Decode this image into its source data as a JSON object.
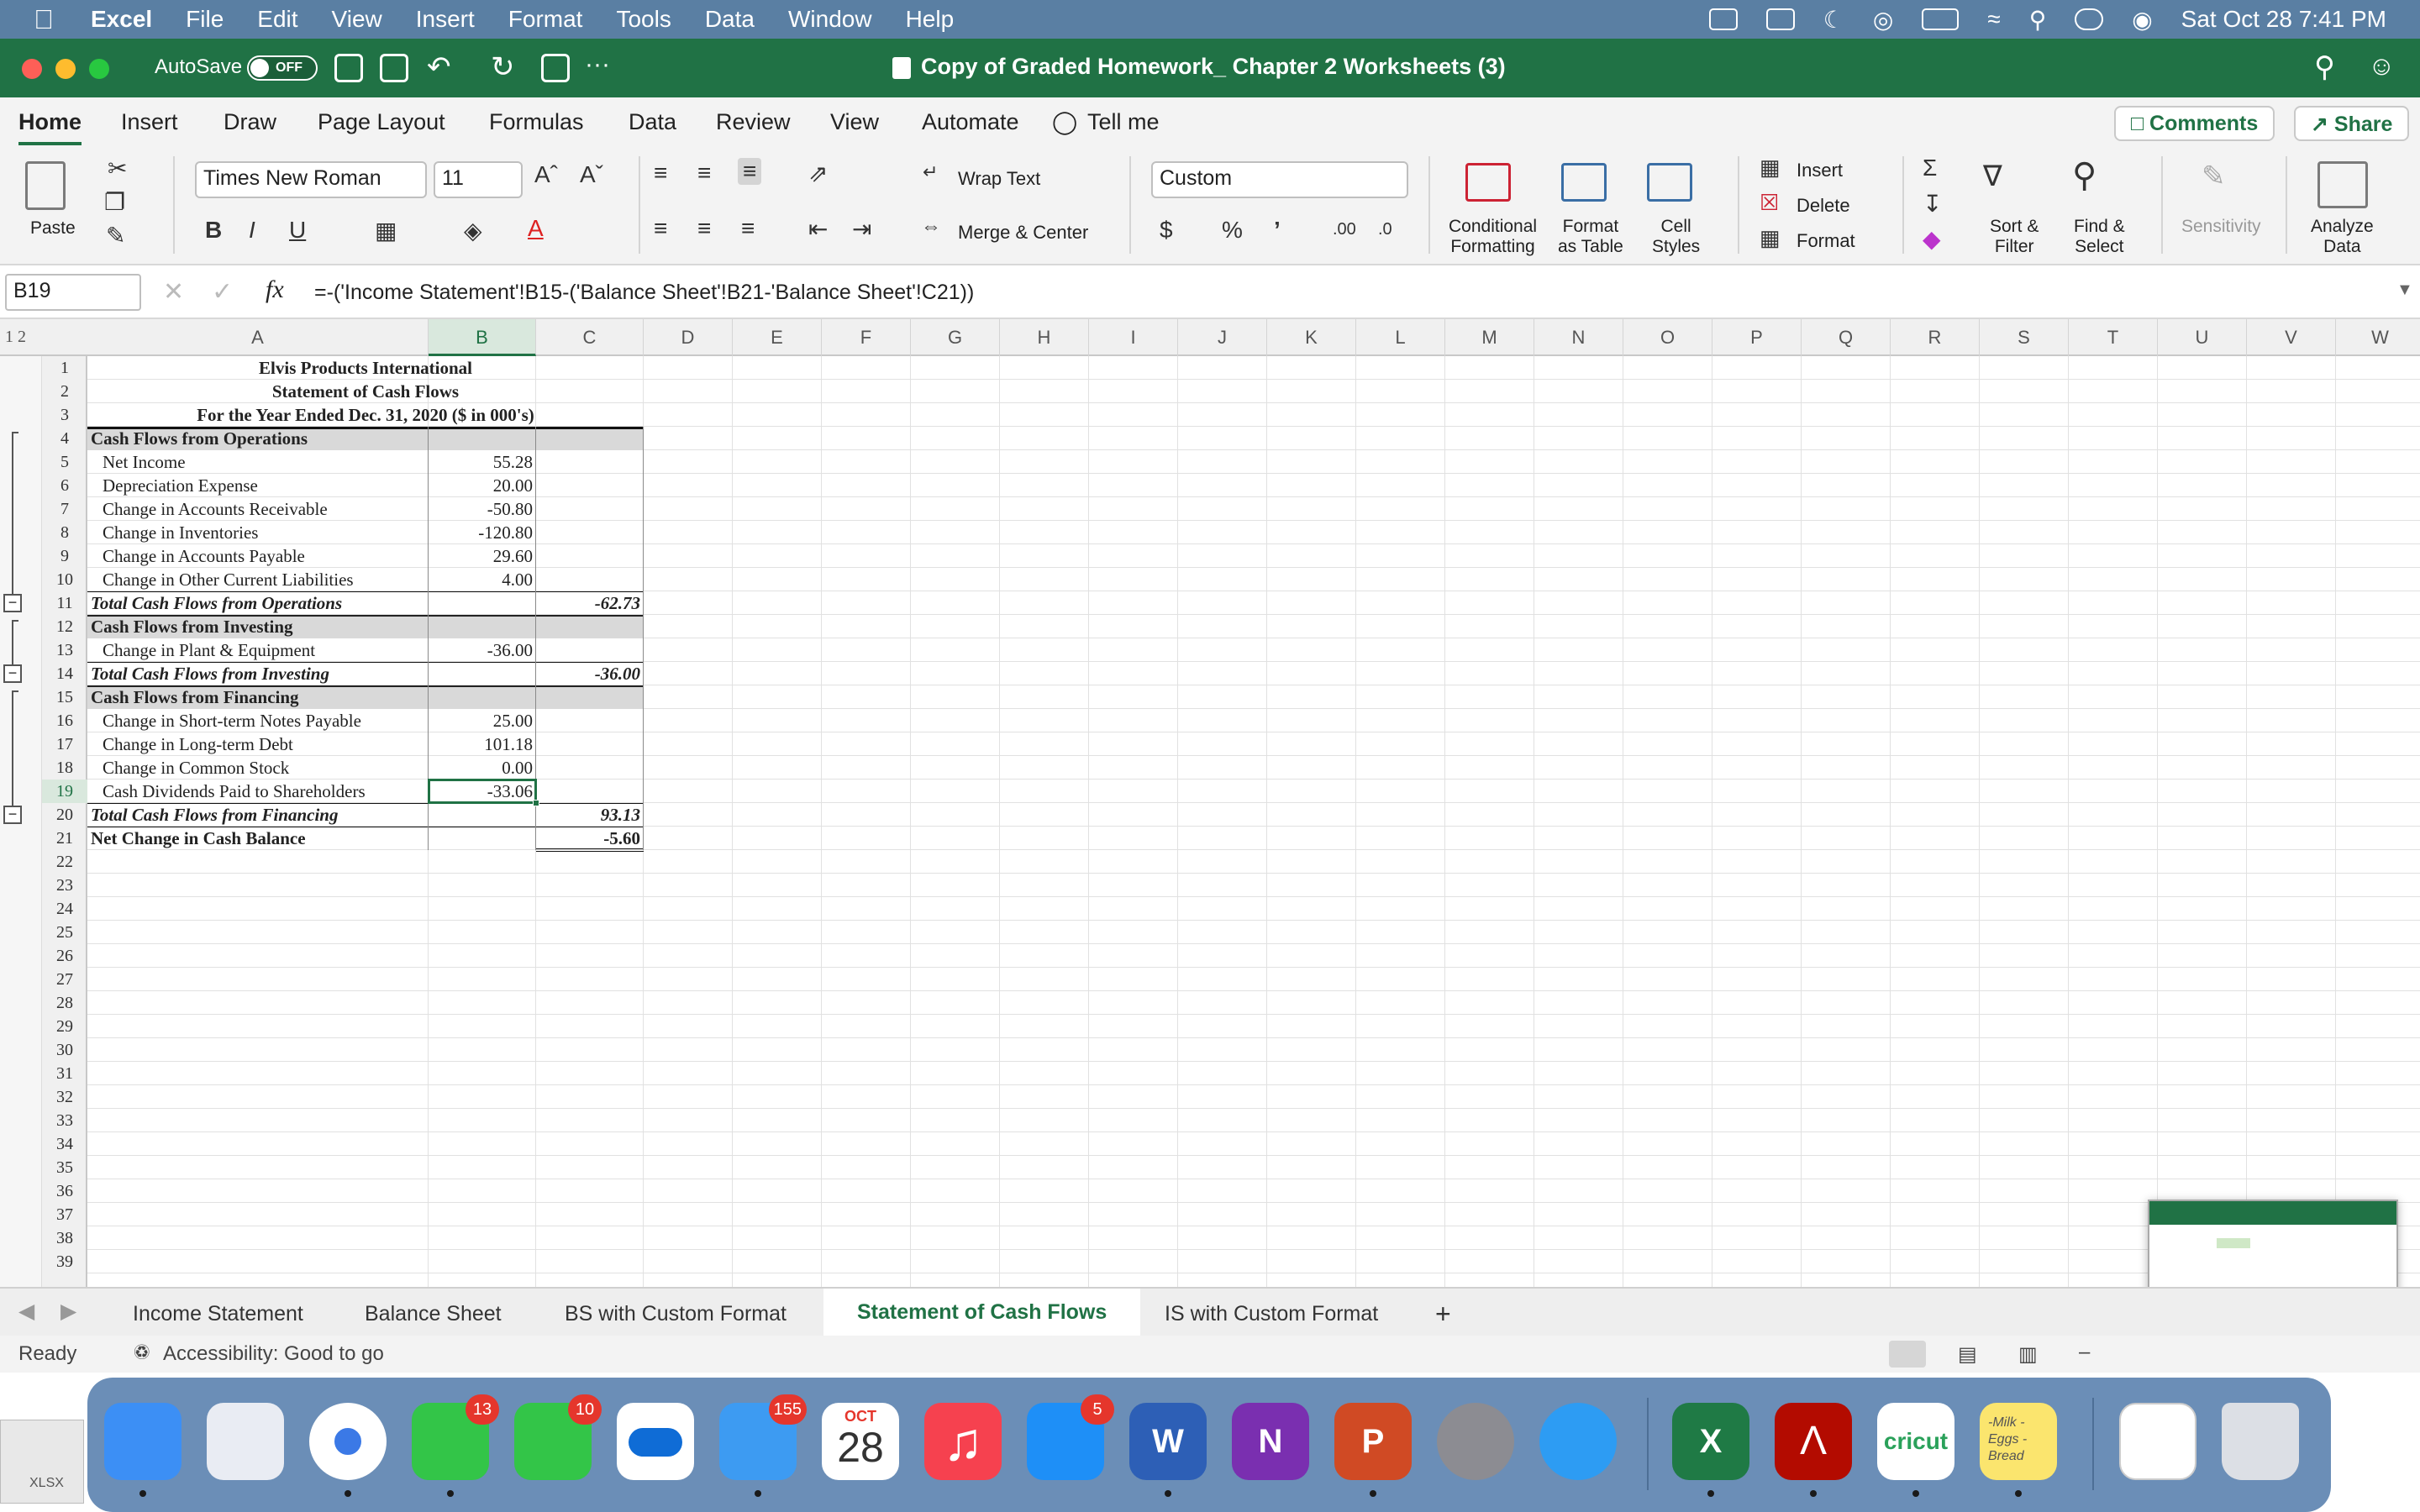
{
  "menubar": {
    "app": "Excel",
    "items": [
      "File",
      "Edit",
      "View",
      "Insert",
      "Format",
      "Tools",
      "Data",
      "Window",
      "Help"
    ],
    "datetime": "Sat Oct 28  7:41 PM"
  },
  "titlebar": {
    "autosave": "AutoSave",
    "autosave_state": "OFF",
    "doc_title": "Copy of Graded Homework_ Chapter 2 Worksheets (3)"
  },
  "ribbon_tabs": [
    "Home",
    "Insert",
    "Draw",
    "Page Layout",
    "Formulas",
    "Data",
    "Review",
    "View",
    "Automate"
  ],
  "tell_me": "Tell me",
  "comments": "Comments",
  "share": "Share",
  "ribbon": {
    "paste": "Paste",
    "font": "Times New Roman",
    "size": "11",
    "wrap_text": "Wrap Text",
    "merge_center": "Merge & Center",
    "number_format": "Custom",
    "conditional": "Conditional",
    "formatting": "Formatting",
    "format": "Format",
    "as_table": "as Table",
    "cell": "Cell",
    "styles": "Styles",
    "insert": "Insert",
    "delete": "Delete",
    "format_cells": "Format",
    "sort": "Sort &",
    "filter": "Filter",
    "find": "Find &",
    "select": "Select",
    "sensitivity": "Sensitivity",
    "analyze": "Analyze",
    "analyze_data": "Data"
  },
  "formula_bar": {
    "name_box": "B19",
    "formula": "=-('Income Statement'!B15-('Balance Sheet'!B21-'Balance Sheet'!C21))"
  },
  "outline_levels": "1 2",
  "columns": [
    "A",
    "B",
    "C",
    "D",
    "E",
    "F",
    "G",
    "H",
    "I",
    "J",
    "K",
    "L",
    "M",
    "N",
    "O",
    "P",
    "Q",
    "R",
    "S",
    "T",
    "U",
    "V",
    "W"
  ],
  "rows": [
    "1",
    "2",
    "3",
    "4",
    "5",
    "6",
    "7",
    "8",
    "9",
    "10",
    "11",
    "12",
    "13",
    "14",
    "15",
    "16",
    "17",
    "18",
    "19",
    "20",
    "21",
    "22",
    "23",
    "24",
    "25",
    "26",
    "27",
    "28",
    "29",
    "30",
    "31",
    "32",
    "33",
    "34",
    "35",
    "36",
    "37",
    "38",
    "39"
  ],
  "statement": {
    "title1": "Elvis Products International",
    "title2": "Statement of Cash Flows",
    "title3": "For the Year Ended Dec. 31, 2020 ($ in 000's)",
    "ops_header": "Cash Flows from Operations",
    "ops_items": [
      {
        "label": "Net Income",
        "value": "55.28"
      },
      {
        "label": "Depreciation Expense",
        "value": "20.00"
      },
      {
        "label": "Change in Accounts Receivable",
        "value": "-50.80"
      },
      {
        "label": "Change in Inventories",
        "value": "-120.80"
      },
      {
        "label": "Change in Accounts Payable",
        "value": "29.60"
      },
      {
        "label": "Change in Other Current Liabilities",
        "value": "4.00"
      }
    ],
    "ops_total_label": "Total Cash Flows from Operations",
    "ops_total": "-62.73",
    "inv_header": "Cash Flows from Investing",
    "inv_items": [
      {
        "label": "Change in Plant & Equipment",
        "value": "-36.00"
      }
    ],
    "inv_total_label": "Total Cash Flows from Investing",
    "inv_total": "-36.00",
    "fin_header": "Cash Flows from Financing",
    "fin_items": [
      {
        "label": "Change in Short-term Notes Payable",
        "value": "25.00"
      },
      {
        "label": "Change in Long-term Debt",
        "value": "101.18"
      },
      {
        "label": "Change in Common Stock",
        "value": "0.00"
      },
      {
        "label": "Cash Dividends Paid to Shareholders",
        "value": "-33.06"
      }
    ],
    "fin_total_label": "Total Cash Flows from Financing",
    "fin_total": "93.13",
    "net_label": "Net Change in Cash Balance",
    "net_value": "-5.60"
  },
  "sheet_tabs": [
    "Income Statement",
    "Balance Sheet",
    "BS with Custom Format",
    "Statement of Cash Flows",
    "IS with Custom Format"
  ],
  "active_sheet": "Statement of Cash Flows",
  "status": {
    "ready": "Ready",
    "accessibility": "Accessibility: Good to go"
  },
  "dock": {
    "messages_badge": "13",
    "facetime_badge": "10",
    "mail_badge": "155",
    "appstore_badge": "5",
    "calendar_month": "OCT",
    "calendar_day": "28",
    "cricut": "cricut",
    "note": "-Milk -Eggs -Bread",
    "xlsx": "XLSX"
  },
  "colors": {
    "excel_green": "#207245",
    "menubar": "#5a7fa3",
    "dock": "#6b8eb7",
    "section_fill": "#d9d9d9"
  }
}
